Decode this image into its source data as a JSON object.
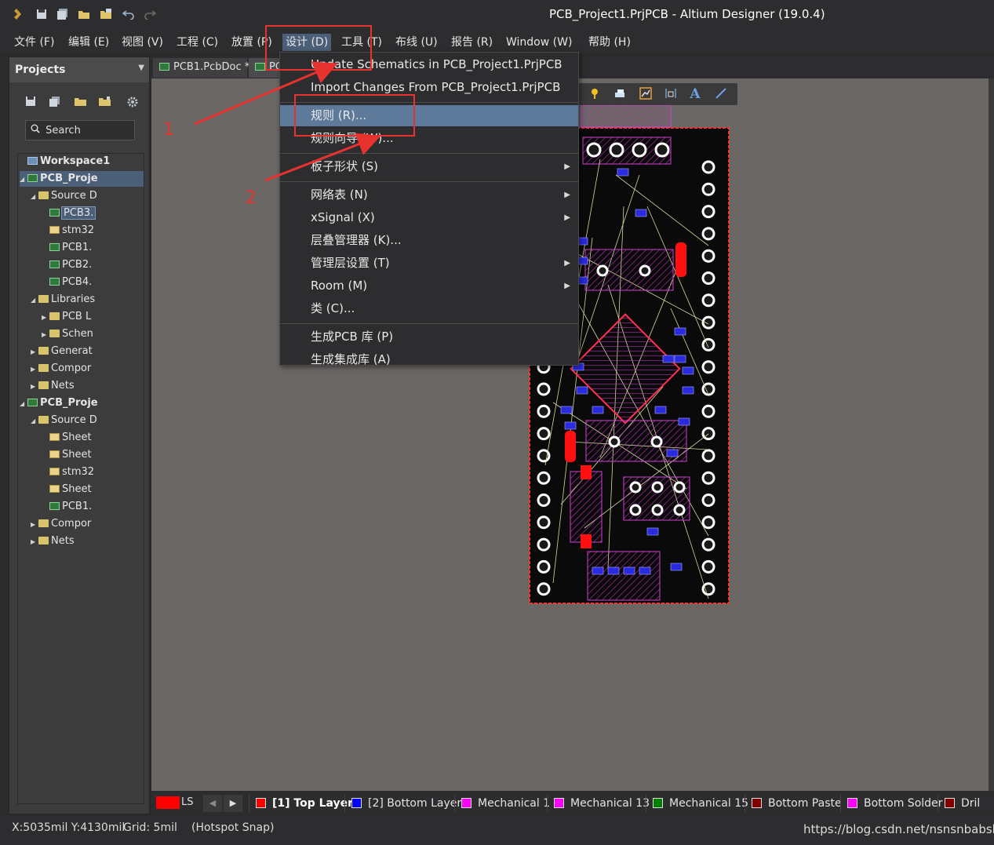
{
  "window": {
    "title": "PCB_Project1.PrjPCB - Altium Designer (19.0.4)"
  },
  "quick_access": [
    "app-logo-icon",
    "save-icon",
    "save-all-icon",
    "open-icon",
    "open-project-icon",
    "undo-icon",
    "redo-icon"
  ],
  "menubar": {
    "items": [
      "文件 (F)",
      "编辑 (E)",
      "视图 (V)",
      "工程 (C)",
      "放置 (P)",
      "设计 (D)",
      "工具 (T)",
      "布线 (U)",
      "报告 (R)",
      "Window (W)",
      "帮助 (H)"
    ],
    "active_index": 5
  },
  "projects_panel": {
    "title": "Projects",
    "search_placeholder": "Search",
    "tree": [
      {
        "label": "Workspace1",
        "icon": "workspace-icon",
        "level": 0,
        "bold": true,
        "expand": ""
      },
      {
        "label": "PCB_Proje",
        "icon": "pcb-project-icon",
        "level": 0,
        "bold": true,
        "expand": "open",
        "selected_row": true
      },
      {
        "label": "Source D",
        "icon": "folder-icon",
        "level": 1,
        "expand": "open"
      },
      {
        "label": "PCB3.",
        "icon": "pcb-doc-icon",
        "level": 2,
        "selected": true
      },
      {
        "label": "stm32",
        "icon": "schematic-doc-icon",
        "level": 2
      },
      {
        "label": "PCB1.",
        "icon": "pcb-doc-icon",
        "level": 2
      },
      {
        "label": "PCB2.",
        "icon": "pcb-doc-icon",
        "level": 2
      },
      {
        "label": "PCB4.",
        "icon": "pcb-doc-icon",
        "level": 2
      },
      {
        "label": "Libraries",
        "icon": "folder-icon",
        "level": 1,
        "expand": "open"
      },
      {
        "label": "PCB L",
        "icon": "folder-icon",
        "level": 2,
        "expand": "closed"
      },
      {
        "label": "Schen",
        "icon": "folder-icon",
        "level": 2,
        "expand": "closed"
      },
      {
        "label": "Generat",
        "icon": "folder-icon",
        "level": 1,
        "expand": "closed"
      },
      {
        "label": "Compor",
        "icon": "folder-icon",
        "level": 1,
        "expand": "closed"
      },
      {
        "label": "Nets",
        "icon": "folder-icon",
        "level": 1,
        "expand": "closed"
      },
      {
        "label": "PCB_Proje",
        "icon": "pcb-project-icon",
        "level": 0,
        "bold": true,
        "expand": "open"
      },
      {
        "label": "Source D",
        "icon": "folder-icon",
        "level": 1,
        "expand": "open"
      },
      {
        "label": "Sheet",
        "icon": "schematic-doc-icon",
        "level": 2
      },
      {
        "label": "Sheet",
        "icon": "schematic-doc-icon",
        "level": 2
      },
      {
        "label": "stm32",
        "icon": "schematic-doc-icon",
        "level": 2
      },
      {
        "label": "Sheet",
        "icon": "schematic-doc-icon",
        "level": 2
      },
      {
        "label": "PCB1.",
        "icon": "pcb-doc-icon",
        "level": 2
      },
      {
        "label": "Compor",
        "icon": "folder-icon",
        "level": 1,
        "expand": "closed"
      },
      {
        "label": "Nets",
        "icon": "folder-icon",
        "level": 1,
        "expand": "closed"
      }
    ]
  },
  "doc_tabs": [
    "PCB1.PcbDoc *",
    "PC"
  ],
  "design_menu": {
    "items": [
      {
        "label": "Update Schematics in PCB_Project1.PrjPCB",
        "submenu": false
      },
      {
        "label": "Import Changes From PCB_Project1.PrjPCB",
        "submenu": false
      },
      {
        "sep": true
      },
      {
        "label": "规则 (R)...",
        "submenu": false,
        "highlighted": true
      },
      {
        "label": "规则向导 (W)...",
        "submenu": false
      },
      {
        "sep": true
      },
      {
        "label": "板子形状 (S)",
        "submenu": true
      },
      {
        "sep": true
      },
      {
        "label": "网络表 (N)",
        "submenu": true
      },
      {
        "label": "xSignal (X)",
        "submenu": true
      },
      {
        "label": "层叠管理器 (K)...",
        "submenu": false
      },
      {
        "label": "管理层设置 (T)",
        "submenu": true
      },
      {
        "label": "Room (M)",
        "submenu": true
      },
      {
        "label": "类 (C)...",
        "submenu": false
      },
      {
        "sep": true
      },
      {
        "label": "生成PCB 库 (P)",
        "submenu": false
      },
      {
        "label": "生成集成库 (A)",
        "submenu": false
      }
    ]
  },
  "pcb_toolbar": {
    "items": [
      "probe-icon",
      "component-icon",
      "graph-icon",
      "dimension-icon",
      "text-icon",
      "line-icon"
    ],
    "text_glyph": "A"
  },
  "layer_tabs": {
    "ls_label": "LS",
    "current_color": "#ff0000",
    "layers": [
      {
        "label": "[1] Top Layer",
        "color": "#ff0000",
        "active": true
      },
      {
        "label": "[2] Bottom Layer",
        "color": "#0000ff"
      },
      {
        "label": "Mechanical 1",
        "color": "#ff00ff"
      },
      {
        "label": "Mechanical 13",
        "color": "#ff00ff"
      },
      {
        "label": "Mechanical 15",
        "color": "#008000"
      },
      {
        "label": "Bottom Paste",
        "color": "#800000"
      },
      {
        "label": "Bottom Solder",
        "color": "#ff00ff"
      },
      {
        "label": "Dril",
        "color": "#800000"
      }
    ]
  },
  "status": {
    "coords": "X:5035mil Y:4130mil",
    "grid": "Grid: 5mil",
    "snap": "(Hotspot Snap)",
    "watermark": "https://blog.csdn.net/nsnsnbabsb"
  },
  "annotations": {
    "step1": "1",
    "step2": "2",
    "color": "#e8322f"
  }
}
